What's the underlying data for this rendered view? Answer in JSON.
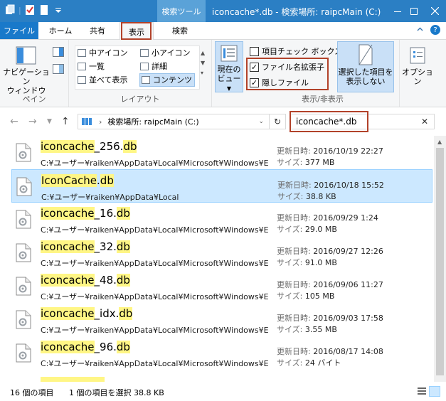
{
  "window": {
    "context_tab": "検索ツール",
    "title": "iconcache*.db - 検索場所: raipcMain (C:)"
  },
  "tabs": {
    "file": "ファイル",
    "home": "ホーム",
    "share": "共有",
    "view": "表示",
    "search": "検索"
  },
  "ribbon": {
    "pane": {
      "nav_pane_line1": "ナビゲーション",
      "nav_pane_line2": "ウィンドウ",
      "group_label": "ペイン"
    },
    "layout": {
      "items": [
        "中アイコン",
        "小アイコン",
        "一覧",
        "詳細",
        "並べて表示",
        "コンテンツ"
      ],
      "group_label": "レイアウト"
    },
    "current_view_line1": "現在の",
    "current_view_line2": "ビュー",
    "showhide": {
      "item_checkboxes": "項目チェック ボックス",
      "file_extensions": "ファイル名拡張子",
      "hidden_items": "隠しファイル",
      "hide_selected_line1": "選択した項目を",
      "hide_selected_line2": "表示しない",
      "group_label": "表示/非表示"
    },
    "options": "オプション"
  },
  "address": {
    "path": "検索場所: raipcMain (C:)"
  },
  "search": {
    "value": "iconcache*.db"
  },
  "meta_labels": {
    "modified": "更新日時:",
    "size": "サイズ:"
  },
  "results": [
    {
      "name_pre": "",
      "name_hl1": "iconcache",
      "name_mid": "_256.",
      "name_hl2": "db",
      "path": "C:¥ユーザー¥raiken¥AppData¥Local¥Microsoft¥Windows¥Ex...",
      "modified": "2016/10/19 22:27",
      "size": "377 MB"
    },
    {
      "name_pre": "",
      "name_hl1": "IconCache",
      "name_mid": ".",
      "name_hl2": "db",
      "path": "C:¥ユーザー¥raiken¥AppData¥Local",
      "modified": "2016/10/18 15:52",
      "size": "38.8 KB"
    },
    {
      "name_pre": "",
      "name_hl1": "iconcache",
      "name_mid": "_16.",
      "name_hl2": "db",
      "path": "C:¥ユーザー¥raiken¥AppData¥Local¥Microsoft¥Windows¥Ex...",
      "modified": "2016/09/29 1:24",
      "size": "29.0 MB"
    },
    {
      "name_pre": "",
      "name_hl1": "iconcache",
      "name_mid": "_32.",
      "name_hl2": "db",
      "path": "C:¥ユーザー¥raiken¥AppData¥Local¥Microsoft¥Windows¥Ex...",
      "modified": "2016/09/27 12:26",
      "size": "91.0 MB"
    },
    {
      "name_pre": "",
      "name_hl1": "iconcache",
      "name_mid": "_48.",
      "name_hl2": "db",
      "path": "C:¥ユーザー¥raiken¥AppData¥Local¥Microsoft¥Windows¥Ex...",
      "modified": "2016/09/06 11:27",
      "size": "105 MB"
    },
    {
      "name_pre": "",
      "name_hl1": "iconcache",
      "name_mid": "_idx.",
      "name_hl2": "db",
      "path": "C:¥ユーザー¥raiken¥AppData¥Local¥Microsoft¥Windows¥Ex...",
      "modified": "2016/09/03 17:58",
      "size": "3.55 MB"
    },
    {
      "name_pre": "",
      "name_hl1": "iconcache",
      "name_mid": "_96.",
      "name_hl2": "db",
      "path": "C:¥ユーザー¥raiken¥AppData¥Local¥Microsoft¥Windows¥Ex...",
      "modified": "2016/08/17 14:08",
      "size": "24 バイト"
    }
  ],
  "status": {
    "item_count": "16 個の項目",
    "selection": "1 個の項目を選択 38.8 KB"
  }
}
